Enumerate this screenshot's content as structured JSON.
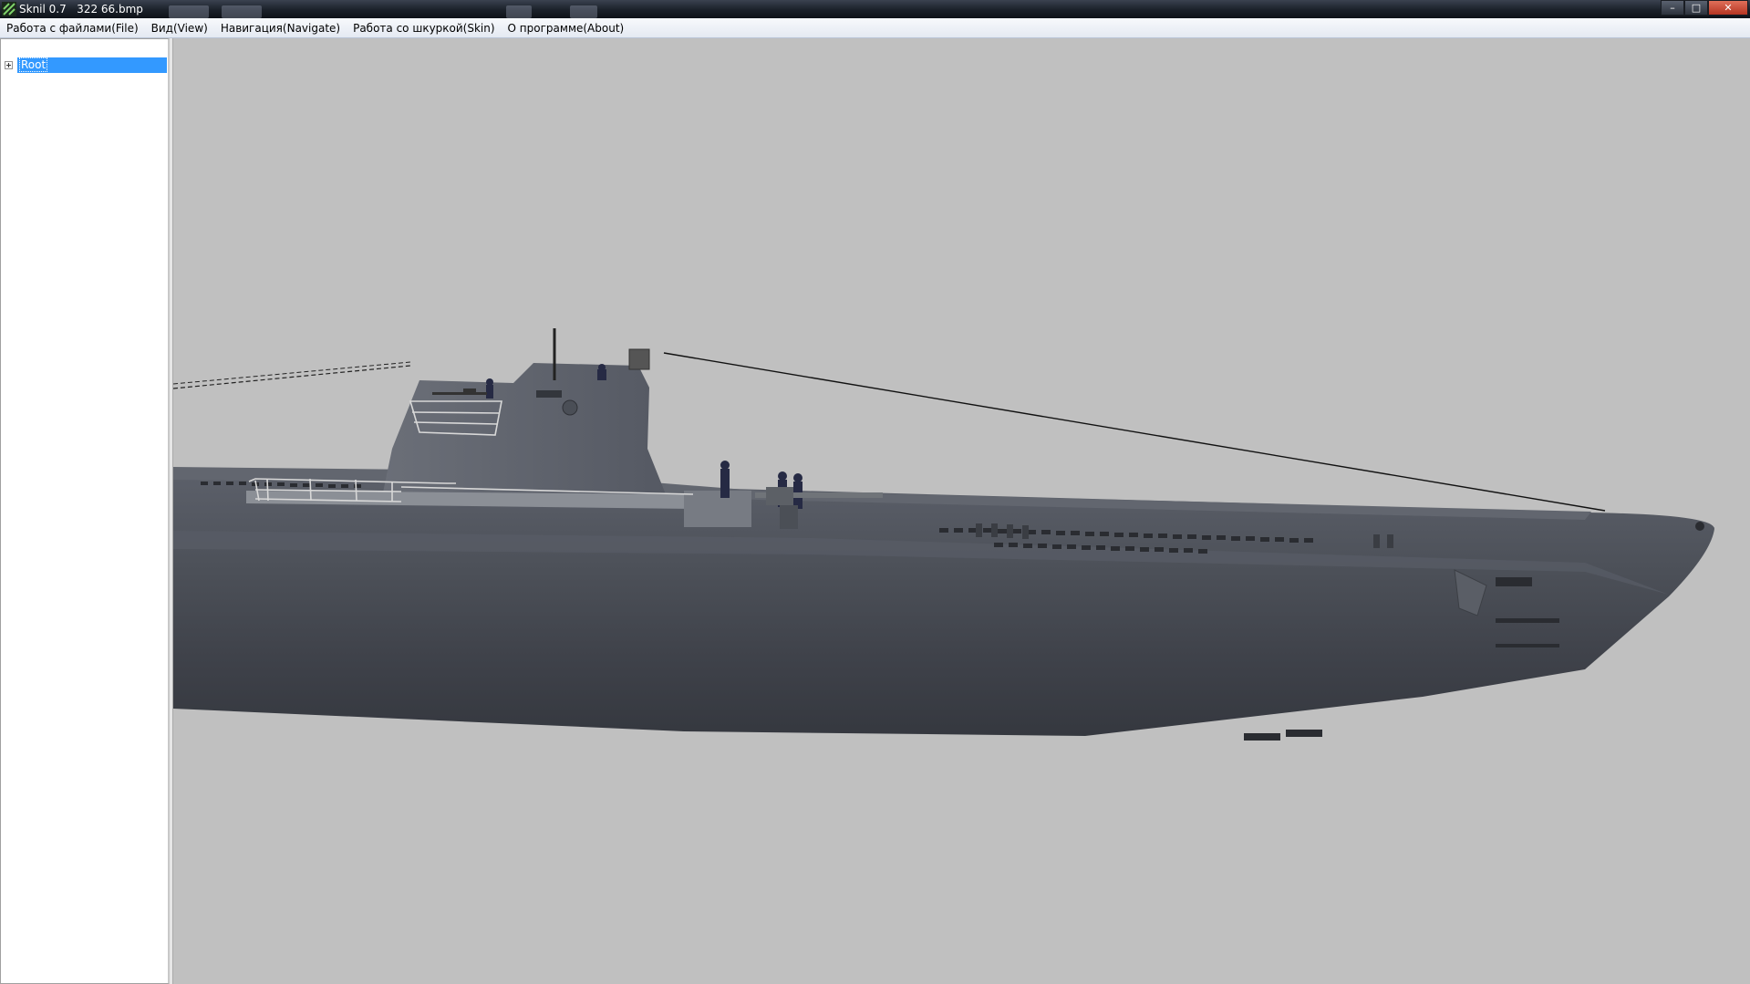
{
  "window": {
    "title": "Sknil 0.7   322 66.bmp",
    "controls": {
      "minimize": "–",
      "maximize": "□",
      "close": "✕"
    }
  },
  "menu": {
    "items": [
      "Работа с файлами(File)",
      "Вид(View)",
      "Навигация(Navigate)",
      "Работа со шкуркой(Skin)",
      "О программе(About)"
    ]
  },
  "tree": {
    "root_label": "Root",
    "expander_icon": "plus-icon"
  },
  "viewport": {
    "background_color": "#c0c0c0",
    "model": "submarine-3d-model",
    "hull_color": "#4b4f58"
  }
}
